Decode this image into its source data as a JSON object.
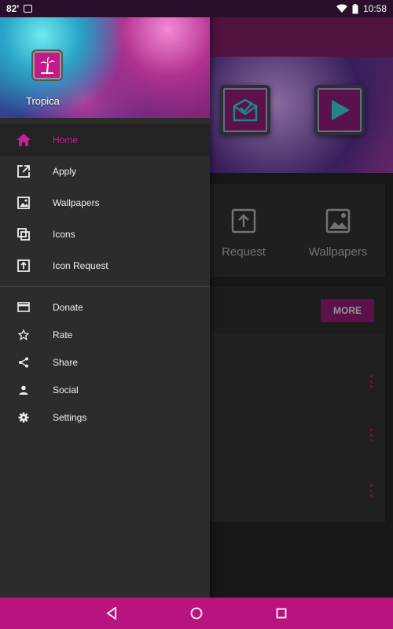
{
  "status_bar": {
    "temperature": "82'",
    "time": "10:58"
  },
  "drawer": {
    "app_name": "Tropica",
    "primary_items": [
      {
        "label": "Home",
        "icon": "home-icon",
        "active": true
      },
      {
        "label": "Apply",
        "icon": "open-external-icon",
        "active": false
      },
      {
        "label": "Wallpapers",
        "icon": "image-icon",
        "active": false
      },
      {
        "label": "Icons",
        "icon": "copy-icon",
        "active": false
      },
      {
        "label": "Icon Request",
        "icon": "upload-icon",
        "active": false
      }
    ],
    "secondary_items": [
      {
        "label": "Donate",
        "icon": "card-icon"
      },
      {
        "label": "Rate",
        "icon": "star-icon"
      },
      {
        "label": "Share",
        "icon": "share-icon"
      },
      {
        "label": "Social",
        "icon": "person-icon"
      },
      {
        "label": "Settings",
        "icon": "gear-icon"
      }
    ]
  },
  "background": {
    "quick_actions": [
      {
        "label": "Request",
        "icon": "upload-icon"
      },
      {
        "label": "Wallpapers",
        "icon": "image-icon"
      }
    ],
    "more_label": "MORE"
  },
  "colors": {
    "accent": "#b8137e",
    "toolbar": "#6b1857",
    "drawer_bg": "#2c2c2c",
    "active_text": "#d01a9a"
  }
}
